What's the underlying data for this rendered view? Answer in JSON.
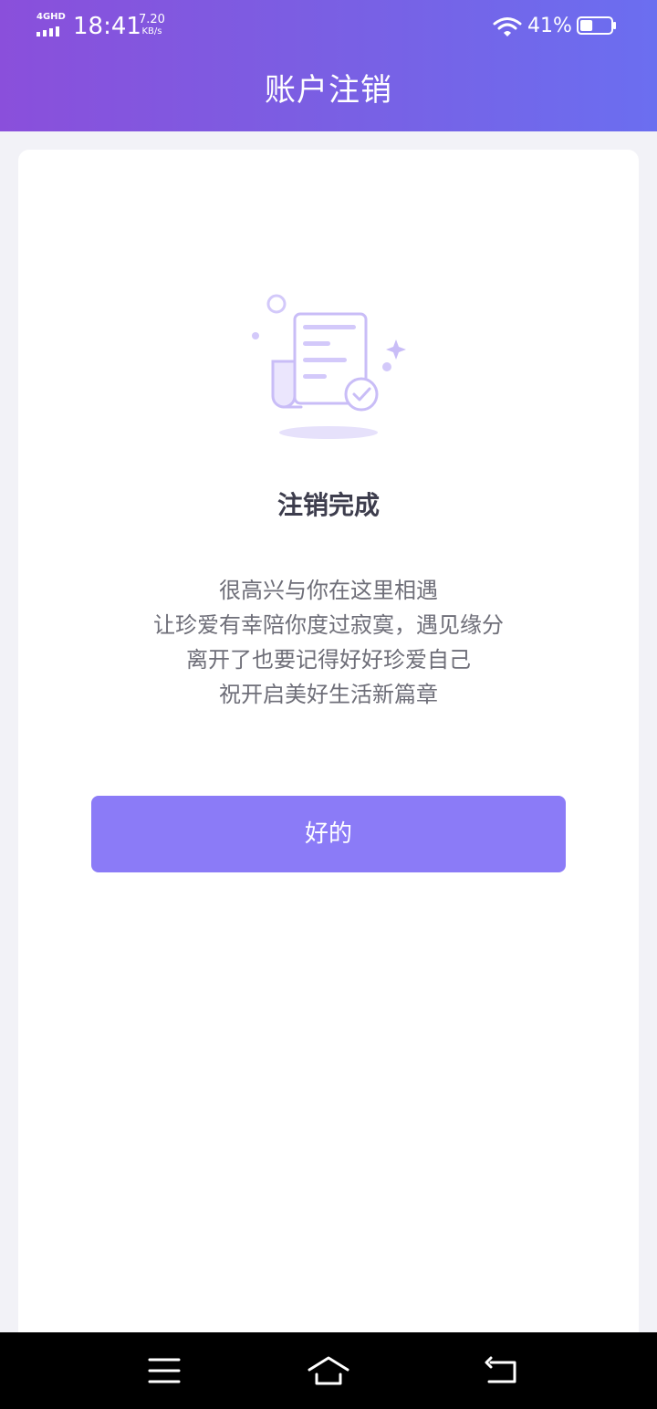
{
  "status_bar": {
    "network": "4GHD",
    "time": "18:41",
    "speed_value": "7.20",
    "speed_unit": "KB/s",
    "battery_percent": "41%",
    "battery_level": 0.41
  },
  "header": {
    "title": "账户注销"
  },
  "content": {
    "illustration_icon": "document-check-icon",
    "title": "注销完成",
    "message_lines": [
      "很高兴与你在这里相遇",
      "让珍爱有幸陪你度过寂寞，遇见缘分",
      "离开了也要记得好好珍爱自己",
      "祝开启美好生活新篇章"
    ],
    "ok_button_label": "好的"
  },
  "nav_bar": {
    "icons": [
      "menu-icon",
      "home-icon",
      "back-icon"
    ]
  },
  "colors": {
    "header_gradient_start": "#8a4fdb",
    "header_gradient_end": "#6b6ef0",
    "button": "#8b7bf7",
    "illustration": "#c9bdf7"
  }
}
